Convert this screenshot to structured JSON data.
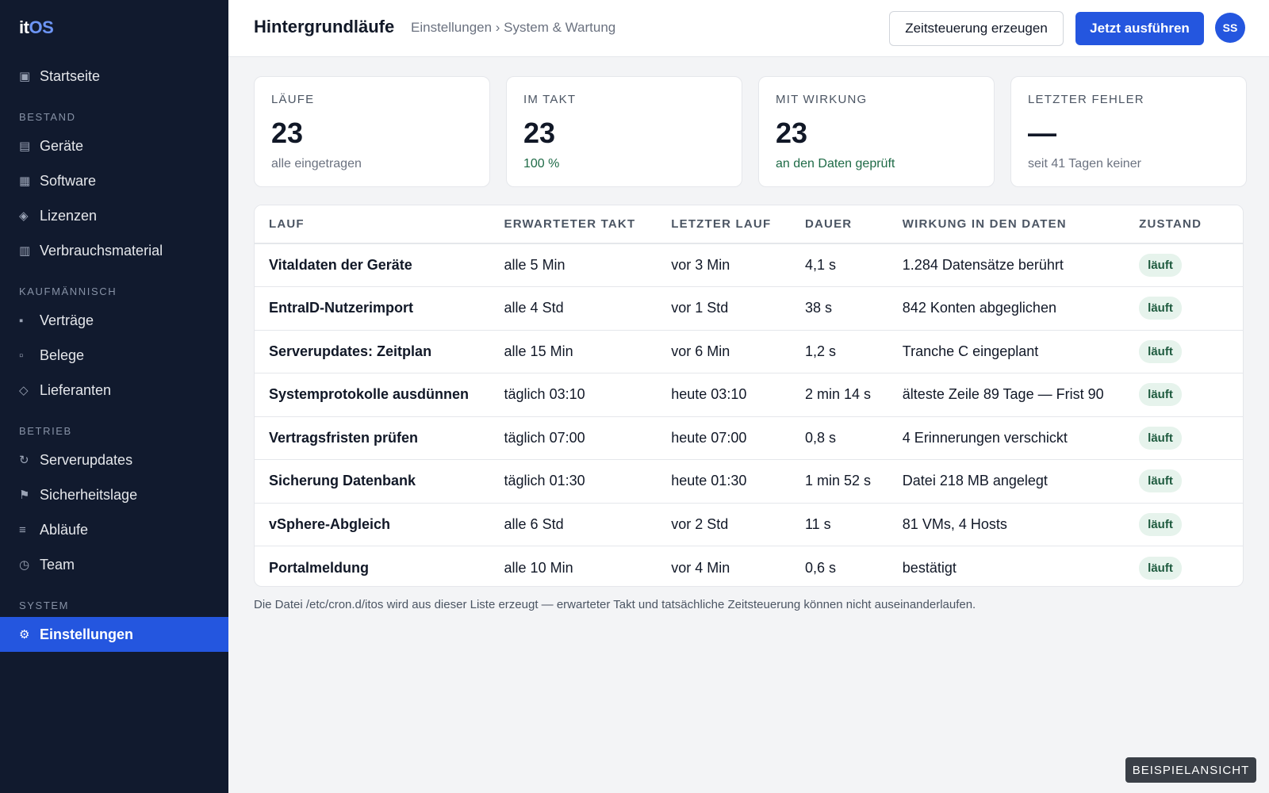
{
  "app": {
    "logo_it": "it",
    "logo_os": "OS"
  },
  "sidebar": {
    "items": [
      {
        "type": "item",
        "label": "Startseite",
        "icon": "▣",
        "icon_name": "home-icon"
      },
      {
        "type": "section",
        "label": "BESTAND"
      },
      {
        "type": "item",
        "label": "Geräte",
        "icon": "▤",
        "icon_name": "devices-icon"
      },
      {
        "type": "item",
        "label": "Software",
        "icon": "▦",
        "icon_name": "software-icon"
      },
      {
        "type": "item",
        "label": "Lizenzen",
        "icon": "◈",
        "icon_name": "license-icon"
      },
      {
        "type": "item",
        "label": "Verbrauchsmaterial",
        "icon": "▥",
        "icon_name": "supplies-icon"
      },
      {
        "type": "section",
        "label": "KAUFMÄNNISCH"
      },
      {
        "type": "item",
        "label": "Verträge",
        "icon": "▪",
        "icon_name": "contract-icon"
      },
      {
        "type": "item",
        "label": "Belege",
        "icon": "▫",
        "icon_name": "receipt-icon"
      },
      {
        "type": "item",
        "label": "Lieferanten",
        "icon": "◇",
        "icon_name": "supplier-icon"
      },
      {
        "type": "section",
        "label": "BETRIEB"
      },
      {
        "type": "item",
        "label": "Serverupdates",
        "icon": "↻",
        "icon_name": "refresh-icon"
      },
      {
        "type": "item",
        "label": "Sicherheitslage",
        "icon": "⚑",
        "icon_name": "flag-icon"
      },
      {
        "type": "item",
        "label": "Abläufe",
        "icon": "≡",
        "icon_name": "list-icon"
      },
      {
        "type": "item",
        "label": "Team",
        "icon": "◷",
        "icon_name": "clock-icon"
      },
      {
        "type": "section",
        "label": "SYSTEM"
      },
      {
        "type": "item",
        "label": "Einstellungen",
        "icon": "⚙",
        "icon_name": "gear-icon",
        "active": true
      }
    ]
  },
  "header": {
    "title": "Hintergrundläufe",
    "breadcrumb": "Einstellungen › System & Wartung",
    "secondary_button": "Zeitsteuerung erzeugen",
    "primary_button": "Jetzt ausführen",
    "avatar": "SS"
  },
  "cards": [
    {
      "label": "LÄUFE",
      "value": "23",
      "sub": "alle eingetragen",
      "sub_style": "muted"
    },
    {
      "label": "IM TAKT",
      "value": "23",
      "sub": "100 %",
      "sub_style": "green"
    },
    {
      "label": "MIT WIRKUNG",
      "value": "23",
      "sub": "an den Daten geprüft",
      "sub_style": "green"
    },
    {
      "label": "LETZTER FEHLER",
      "value": "—",
      "sub": "seit 41 Tagen keiner",
      "sub_style": "muted"
    }
  ],
  "table": {
    "columns": [
      "LAUF",
      "ERWARTETER TAKT",
      "LETZTER LAUF",
      "DAUER",
      "WIRKUNG IN DEN DATEN",
      "ZUSTAND"
    ],
    "rows": [
      [
        "Vitaldaten der Geräte",
        "alle 5 Min",
        "vor 3 Min",
        "4,1 s",
        "1.284 Datensätze berührt",
        "läuft"
      ],
      [
        "EntraID-Nutzerimport",
        "alle 4 Std",
        "vor 1 Std",
        "38 s",
        "842 Konten abgeglichen",
        "läuft"
      ],
      [
        "Serverupdates: Zeitplan",
        "alle 15 Min",
        "vor 6 Min",
        "1,2 s",
        "Tranche C eingeplant",
        "läuft"
      ],
      [
        "Systemprotokolle ausdünnen",
        "täglich 03:10",
        "heute 03:10",
        "2 min 14 s",
        "älteste Zeile 89 Tage — Frist 90",
        "läuft"
      ],
      [
        "Vertragsfristen prüfen",
        "täglich 07:00",
        "heute 07:00",
        "0,8 s",
        "4 Erinnerungen verschickt",
        "läuft"
      ],
      [
        "Sicherung Datenbank",
        "täglich 01:30",
        "heute 01:30",
        "1 min 52 s",
        "Datei 218 MB angelegt",
        "läuft"
      ],
      [
        "vSphere-Abgleich",
        "alle 6 Std",
        "vor 2 Std",
        "11 s",
        "81 VMs, 4 Hosts",
        "läuft"
      ],
      [
        "Portalmeldung",
        "alle 10 Min",
        "vor 4 Min",
        "0,6 s",
        "bestätigt",
        "läuft"
      ]
    ]
  },
  "footnote": "Die Datei /etc/cron.d/itos wird aus dieser Liste erzeugt — erwarteter Takt und tatsächliche Zeitsteuerung können nicht auseinanderlaufen.",
  "demo_badge": "BEISPIELANSICHT",
  "colors": {
    "sidebar": "#111a2e",
    "accent": "#2456df",
    "logo_accent": "#6d95f5",
    "status_ok_bg": "#e6f3ec",
    "status_ok_text": "#1f5b3f"
  }
}
